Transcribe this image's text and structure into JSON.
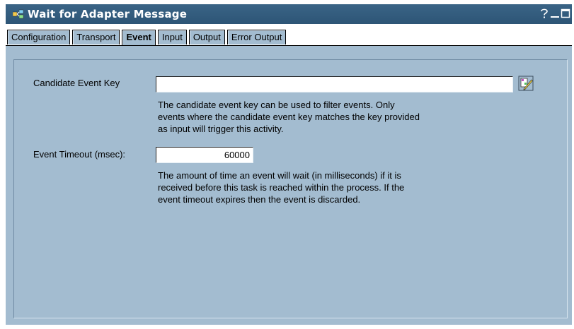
{
  "window": {
    "title": "Wait for Adapter Message"
  },
  "tabs": [
    {
      "label": "Configuration"
    },
    {
      "label": "Transport"
    },
    {
      "label": "Event"
    },
    {
      "label": "Input"
    },
    {
      "label": "Output"
    },
    {
      "label": "Error Output"
    }
  ],
  "active_tab": "Event",
  "candidate_key": {
    "label": "Candidate Event Key",
    "value": "",
    "help_line1": "The candidate event key can be used to filter events. Only",
    "help_line2": "events where the candidate event key matches the key provided",
    "help_line3": "as input will trigger this activity."
  },
  "event_timeout": {
    "label": "Event Timeout (msec):",
    "value": "60000",
    "help_line1": "The amount of time an event will wait (in milliseconds) if it is",
    "help_line2": "received before this task is reached within the process. If the",
    "help_line3": "event timeout expires then the event is discarded."
  },
  "icons": {
    "app": "app-icon",
    "help": "help-icon",
    "minimize": "minimize-icon",
    "maximize": "maximize-icon",
    "picker": "edit-picker-icon"
  },
  "colors": {
    "titlebar": "#2d5576",
    "panel": "#a3bcd0",
    "title_text": "#ffffff"
  }
}
